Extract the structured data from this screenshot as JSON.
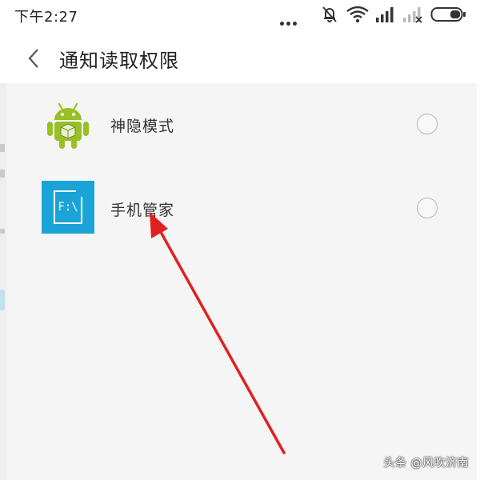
{
  "status_bar": {
    "time": "下午2:27"
  },
  "header": {
    "back_icon": "chevron-left-icon",
    "title": "通知读取权限"
  },
  "apps": [
    {
      "label": "神隐模式",
      "icon": "android-cube-icon",
      "selected": false
    },
    {
      "label": "手机管家",
      "icon": "file-manager-icon",
      "icon_text": "F:\\",
      "selected": false
    }
  ],
  "watermark": "头条 @风吹济南",
  "colors": {
    "accent_arrow": "#e02020",
    "content_bg": "#f5f5f5",
    "fm_icon_bg": "#1aa3d6",
    "android_green": "#97c024"
  }
}
